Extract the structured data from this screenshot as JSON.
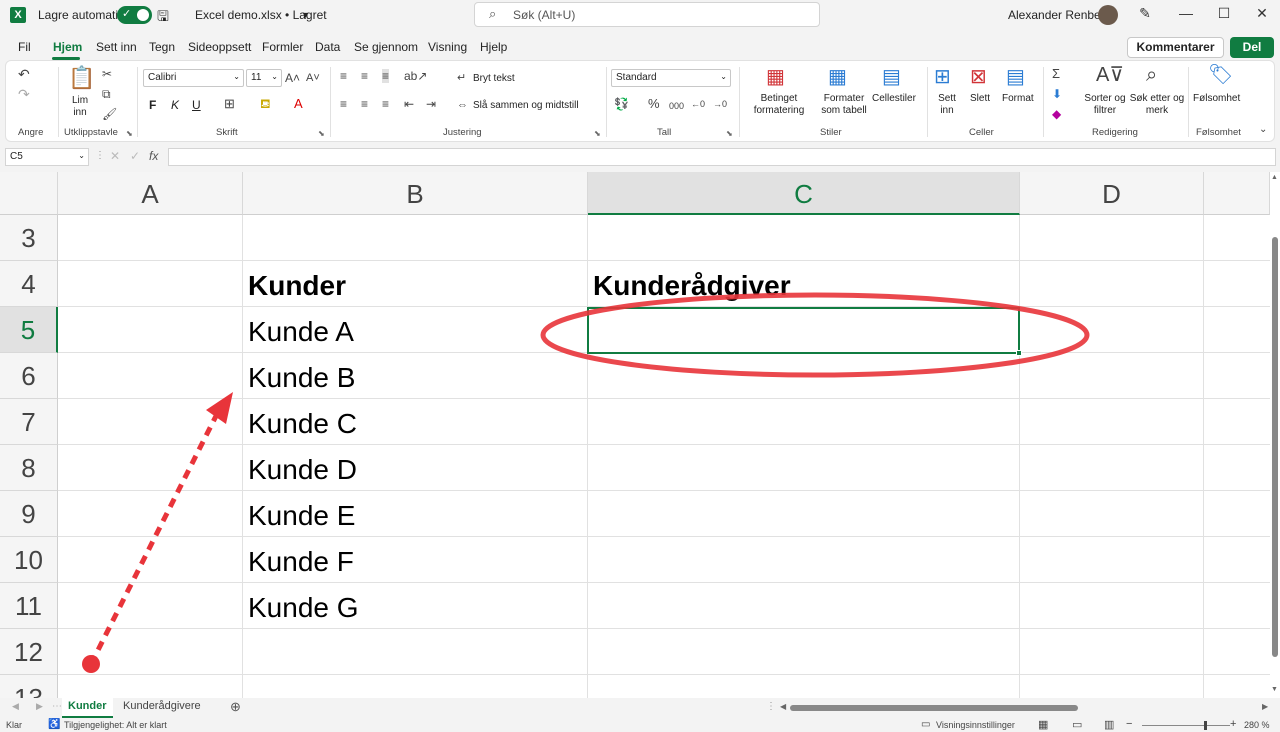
{
  "titlebar": {
    "autosave_label": "Lagre automatisk",
    "file_title": "Excel demo.xlsx • Lagret",
    "search_placeholder": "Søk (Alt+U)",
    "user_name": "Alexander Renberg"
  },
  "menu": {
    "items": [
      "Fil",
      "Hjem",
      "Sett inn",
      "Tegn",
      "Sideoppsett",
      "Formler",
      "Data",
      "Se gjennom",
      "Visning",
      "Hjelp"
    ],
    "comments_button": "Kommentarer",
    "share_button": "Del"
  },
  "ribbon": {
    "groups": {
      "undo": "Angre",
      "clipboard": "Utklippstavle",
      "font": "Skrift",
      "alignment": "Justering",
      "number": "Tall",
      "styles": "Stiler",
      "cells": "Celler",
      "editing": "Redigering",
      "sensitivity": "Følsomhet"
    },
    "paste": "Lim inn",
    "font_name": "Calibri",
    "font_size": "11",
    "bold": "F",
    "italic": "K",
    "underline": "U",
    "wrap_text": "Bryt tekst",
    "merge_center": "Slå sammen og midtstill",
    "number_format": "Standard",
    "conditional_formatting": "Betinget formatering",
    "format_as_table": "Formater som tabell",
    "cell_styles": "Cellestiler",
    "insert": "Sett inn",
    "delete": "Slett",
    "format": "Format",
    "sort_filter": "Sorter og filtrer",
    "find_select": "Søk etter og merk",
    "sensitivity": "Følsomhet"
  },
  "formula_bar": {
    "name_box": "C5",
    "fx": "fx",
    "content": ""
  },
  "grid": {
    "columns": [
      "A",
      "B",
      "C",
      "D"
    ],
    "selected_column": "C",
    "rows": [
      "3",
      "4",
      "5",
      "6",
      "7",
      "8",
      "9",
      "10",
      "11",
      "12",
      "13"
    ],
    "selected_row": "5",
    "cells": {
      "B4": "Kunder",
      "C4": "Kunderådgiver",
      "B5": "Kunde A",
      "B6": "Kunde B",
      "B7": "Kunde C",
      "B8": "Kunde D",
      "B9": "Kunde E",
      "B10": "Kunde F",
      "B11": "Kunde G"
    }
  },
  "sheets": {
    "tabs": [
      "Kunder",
      "Kunderådgivere"
    ],
    "active": "Kunder"
  },
  "status": {
    "ready": "Klar",
    "accessibility": "Tilgjengelighet: Alt er klart",
    "view_settings": "Visningsinnstillinger",
    "zoom": "280 %"
  },
  "colors": {
    "accent": "#107c41",
    "annotation": "#e8343a"
  }
}
